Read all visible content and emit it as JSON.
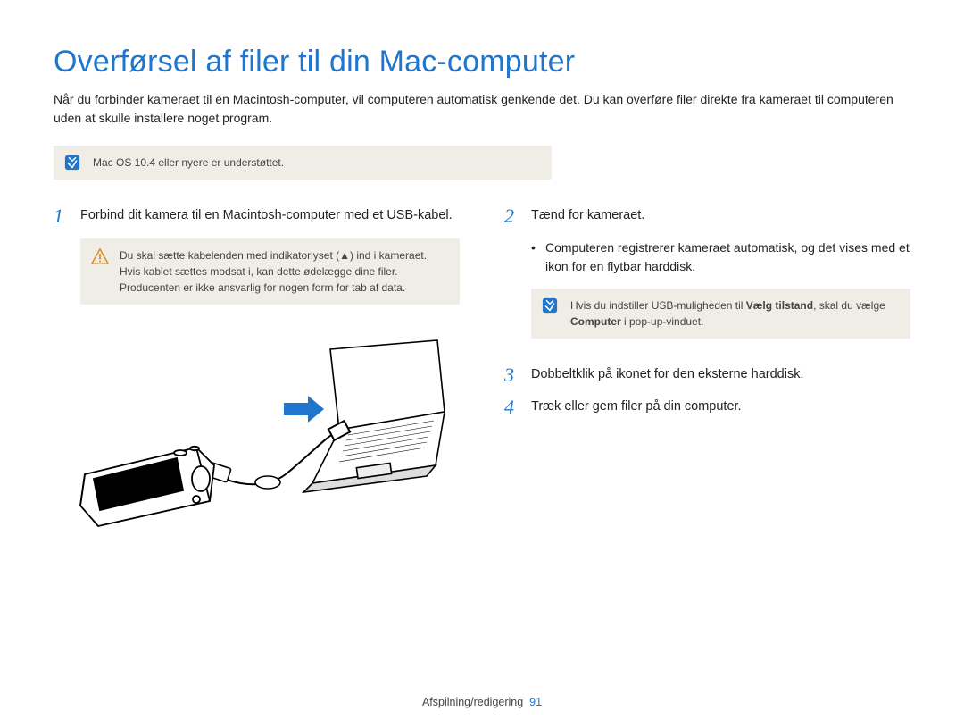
{
  "title": "Overførsel af filer til din Mac-computer",
  "intro": "Når du forbinder kameraet til en Macintosh-computer, vil computeren automatisk genkende det. Du kan overføre filer direkte fra kameraet til computeren uden at skulle installere noget program.",
  "note_top": "Mac OS 10.4 eller nyere er understøttet.",
  "left": {
    "step1_num": "1",
    "step1": "Forbind dit kamera til en Macintosh-computer med et USB-kabel.",
    "warn": "Du skal sætte kabelenden med indikatorlyset (▲) ind i kameraet. Hvis kablet sættes modsat i, kan dette ødelægge dine filer. Producenten er ikke ansvarlig for nogen form for tab af data."
  },
  "right": {
    "step2_num": "2",
    "step2": "Tænd for kameraet.",
    "bullet": "Computeren registrerer kameraet automatisk, og det vises med et ikon for en flytbar harddisk.",
    "note_pre": "Hvis du indstiller USB-muligheden til ",
    "note_bold1": "Vælg tilstand",
    "note_mid": ", skal du vælge ",
    "note_bold2": "Computer",
    "note_post": " i pop-up-vinduet.",
    "step3_num": "3",
    "step3": "Dobbeltklik på ikonet for den eksterne harddisk.",
    "step4_num": "4",
    "step4": "Træk eller gem filer på din computer."
  },
  "footer_section": "Afspilning/redigering",
  "footer_page": "91"
}
